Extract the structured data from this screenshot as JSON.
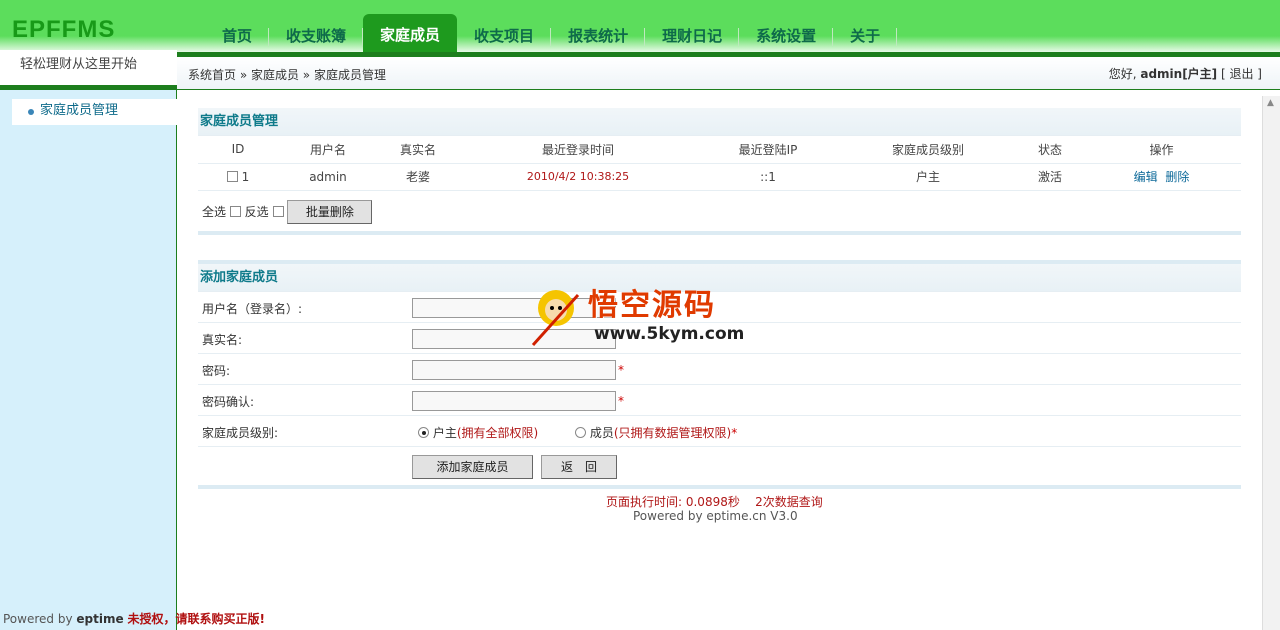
{
  "app": {
    "logo": "EPFFMS",
    "slogan": "轻松理财从这里开始"
  },
  "nav": [
    {
      "label": "首页"
    },
    {
      "label": "收支账簿"
    },
    {
      "label": "家庭成员",
      "active": true
    },
    {
      "label": "收支项目"
    },
    {
      "label": "报表统计"
    },
    {
      "label": "理财日记"
    },
    {
      "label": "系统设置"
    },
    {
      "label": "关于"
    }
  ],
  "breadcrumb": "系统首页 » 家庭成员 » 家庭成员管理",
  "user": {
    "greeting": "您好,",
    "name": "admin[户主]",
    "logout": "[ 退出 ]"
  },
  "sidebar": {
    "items": [
      {
        "label": "家庭成员管理"
      }
    ],
    "footer_powered": "Powered by",
    "footer_brand": "eptime",
    "footer_warning": "未授权，请联系购买正版!"
  },
  "members": {
    "title": "家庭成员管理",
    "columns": [
      "ID",
      "用户名",
      "真实名",
      "最近登录时间",
      "最近登陆IP",
      "家庭成员级别",
      "状态",
      "操作"
    ],
    "rows": [
      {
        "id": "1",
        "username": "admin",
        "realname": "老婆",
        "last_login": "2010/4/2 10:38:25",
        "ip": "::1",
        "level": "户主",
        "status": "激活",
        "edit": "编辑",
        "delete": "删除"
      }
    ],
    "select_all": "全选",
    "invert": "反选",
    "batch_delete": "批量删除"
  },
  "add_form": {
    "title": "添加家庭成员",
    "fields": [
      {
        "label": "用户名（登录名）:",
        "value": ""
      },
      {
        "label": "真实名:",
        "value": ""
      },
      {
        "label": "密码:",
        "value": "",
        "required": "*"
      },
      {
        "label": "密码确认:",
        "value": "",
        "required": "*"
      }
    ],
    "level_label": "家庭成员级别:",
    "options": [
      {
        "label": "户主",
        "note": "(拥有全部权限)",
        "checked": true
      },
      {
        "label": "成员",
        "note": "(只拥有数据管理权限)",
        "checked": false
      }
    ],
    "level_required": "*",
    "submit": "添加家庭成员",
    "back": "返　回"
  },
  "watermark": {
    "text": "悟空源码",
    "url": "www.5kym.com"
  },
  "footer": {
    "exec": "页面执行时间: 0.0898秒",
    "queries": "2次数据查询",
    "powered": "Powered by eptime.cn V3.0"
  },
  "colors": {
    "header": "#5cdd5c",
    "active_tab": "#1e9a1e",
    "accent_dark": "#1d7e1d",
    "sidebar": "#d6f0fb",
    "warning": "#b01818"
  }
}
